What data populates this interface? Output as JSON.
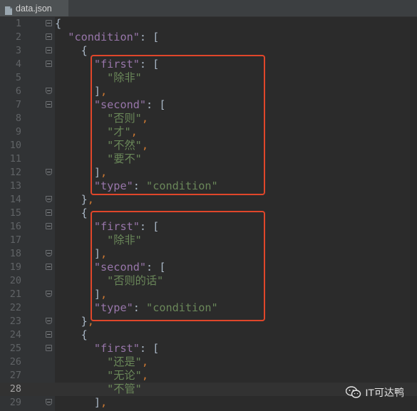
{
  "tab": {
    "filename": "data.json",
    "icon": "json-file-icon"
  },
  "editor": {
    "current_line": 28,
    "lines": [
      {
        "n": "1",
        "segs": [
          [
            "b",
            "{"
          ]
        ]
      },
      {
        "n": "2",
        "segs": [
          [
            "b",
            "  "
          ],
          [
            "k",
            "\"condition\""
          ],
          [
            "b",
            ": ["
          ]
        ]
      },
      {
        "n": "3",
        "segs": [
          [
            "b",
            "    {"
          ]
        ]
      },
      {
        "n": "4",
        "segs": [
          [
            "b",
            "      "
          ],
          [
            "k",
            "\"first\""
          ],
          [
            "b",
            ": ["
          ]
        ]
      },
      {
        "n": "5",
        "segs": [
          [
            "b",
            "        "
          ],
          [
            "s",
            "\"除非\""
          ]
        ]
      },
      {
        "n": "6",
        "segs": [
          [
            "b",
            "      ]"
          ],
          [
            "p",
            ","
          ]
        ]
      },
      {
        "n": "7",
        "segs": [
          [
            "b",
            "      "
          ],
          [
            "k",
            "\"second\""
          ],
          [
            "b",
            ": ["
          ]
        ]
      },
      {
        "n": "8",
        "segs": [
          [
            "b",
            "        "
          ],
          [
            "s",
            "\"否则\""
          ],
          [
            "p",
            ","
          ]
        ]
      },
      {
        "n": "9",
        "segs": [
          [
            "b",
            "        "
          ],
          [
            "s",
            "\"才\""
          ],
          [
            "p",
            ","
          ]
        ]
      },
      {
        "n": "10",
        "segs": [
          [
            "b",
            "        "
          ],
          [
            "s",
            "\"不然\""
          ],
          [
            "p",
            ","
          ]
        ]
      },
      {
        "n": "11",
        "segs": [
          [
            "b",
            "        "
          ],
          [
            "s",
            "\"要不\""
          ]
        ]
      },
      {
        "n": "12",
        "segs": [
          [
            "b",
            "      ]"
          ],
          [
            "p",
            ","
          ]
        ]
      },
      {
        "n": "13",
        "segs": [
          [
            "b",
            "      "
          ],
          [
            "k",
            "\"type\""
          ],
          [
            "b",
            ": "
          ],
          [
            "s",
            "\"condition\""
          ]
        ]
      },
      {
        "n": "14",
        "segs": [
          [
            "b",
            "    }"
          ],
          [
            "p",
            ","
          ]
        ]
      },
      {
        "n": "15",
        "segs": [
          [
            "b",
            "    {"
          ]
        ]
      },
      {
        "n": "16",
        "segs": [
          [
            "b",
            "      "
          ],
          [
            "k",
            "\"first\""
          ],
          [
            "b",
            ": ["
          ]
        ]
      },
      {
        "n": "17",
        "segs": [
          [
            "b",
            "        "
          ],
          [
            "s",
            "\"除非\""
          ]
        ]
      },
      {
        "n": "18",
        "segs": [
          [
            "b",
            "      ]"
          ],
          [
            "p",
            ","
          ]
        ]
      },
      {
        "n": "19",
        "segs": [
          [
            "b",
            "      "
          ],
          [
            "k",
            "\"second\""
          ],
          [
            "b",
            ": ["
          ]
        ]
      },
      {
        "n": "20",
        "segs": [
          [
            "b",
            "        "
          ],
          [
            "s",
            "\"否则的话\""
          ]
        ]
      },
      {
        "n": "21",
        "segs": [
          [
            "b",
            "      ]"
          ],
          [
            "p",
            ","
          ]
        ]
      },
      {
        "n": "22",
        "segs": [
          [
            "b",
            "      "
          ],
          [
            "k",
            "\"type\""
          ],
          [
            "b",
            ": "
          ],
          [
            "s",
            "\"condition\""
          ]
        ]
      },
      {
        "n": "23",
        "segs": [
          [
            "b",
            "    }"
          ],
          [
            "p",
            ","
          ]
        ]
      },
      {
        "n": "24",
        "segs": [
          [
            "b",
            "    {"
          ]
        ]
      },
      {
        "n": "25",
        "segs": [
          [
            "b",
            "      "
          ],
          [
            "k",
            "\"first\""
          ],
          [
            "b",
            ": ["
          ]
        ]
      },
      {
        "n": "26",
        "segs": [
          [
            "b",
            "        "
          ],
          [
            "s",
            "\"还是\""
          ],
          [
            "p",
            ","
          ]
        ]
      },
      {
        "n": "27",
        "segs": [
          [
            "b",
            "        "
          ],
          [
            "s",
            "\"无论\""
          ],
          [
            "p",
            ","
          ]
        ]
      },
      {
        "n": "28",
        "segs": [
          [
            "b",
            "        "
          ],
          [
            "s",
            "\"不管\""
          ]
        ]
      },
      {
        "n": "29",
        "segs": [
          [
            "b",
            "      ]"
          ],
          [
            "p",
            ","
          ]
        ]
      }
    ]
  },
  "colors": {
    "highlight_box": "#e0462a",
    "key": "#9876aa",
    "string": "#6a8759",
    "punct": "#cc7832"
  },
  "watermark": {
    "text": "IT可达鸭",
    "icon": "wechat-icon"
  }
}
